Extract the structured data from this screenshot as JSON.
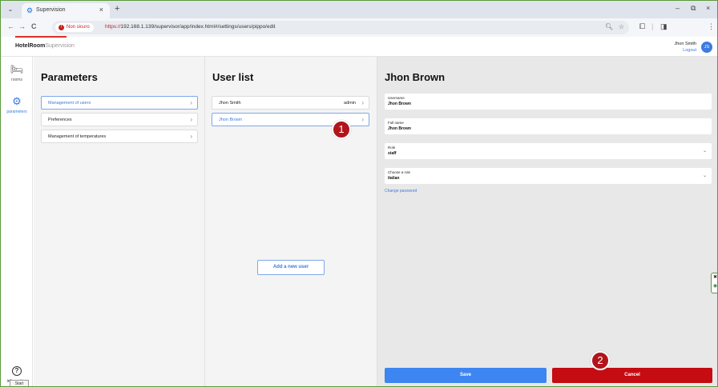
{
  "browser": {
    "tab_title": "Supervision",
    "tab_close": "×",
    "new_tab": "+",
    "tab_menu": "⌄",
    "security_label": "Non sicuro",
    "url_scheme": "https://",
    "url_rest": "192.168.1.139/supervisor/app/index.html#/settings/users/pippo/edit",
    "controls": {
      "minimize": "–",
      "maximize": "⧉",
      "close": "×"
    }
  },
  "app": {
    "brand_bold": "HotelRoom",
    "brand_light": "Supervision",
    "user_name": "Jhon Smith",
    "logout_label": "Logout",
    "avatar_initials": "JS"
  },
  "rail": {
    "rooms_label": "rooms",
    "parameters_label": "parameters",
    "information_label": "information",
    "start_label": "Start"
  },
  "parameters": {
    "title": "Parameters",
    "items": [
      {
        "label": "Management of users"
      },
      {
        "label": "Preferences"
      },
      {
        "label": "Management of temperatures"
      }
    ]
  },
  "user_list": {
    "title": "User list",
    "users": [
      {
        "name": "Jhon Smith",
        "role": "admin"
      },
      {
        "name": "Jhon Brown",
        "role": ""
      }
    ],
    "add_user_label": "Add a new user"
  },
  "detail": {
    "title": "Jhon Brown",
    "username": {
      "label": "Username",
      "value": "Jhon Brown"
    },
    "full_name": {
      "label": "Full name",
      "value": "Jhon Brown"
    },
    "role": {
      "label": "Role",
      "value": "staff"
    },
    "language": {
      "label": "Choose a role",
      "value": "italian"
    },
    "change_password_label": "Change password",
    "save_label": "Save",
    "cancel_label": "Cancel"
  },
  "annotations": {
    "badge1": "1",
    "badge2": "2"
  },
  "colors": {
    "accent": "#3d7be0",
    "cancel": "#c40c12",
    "badge": "#b1141b"
  }
}
